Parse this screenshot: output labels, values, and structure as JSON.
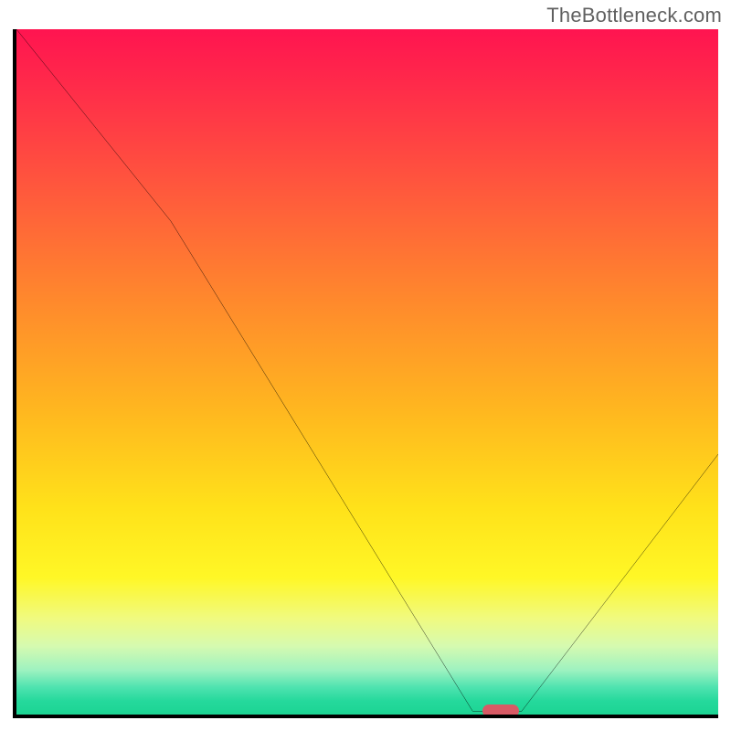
{
  "watermark": "TheBottleneck.com",
  "plot": {
    "x_range": [
      0,
      100
    ],
    "y_range": [
      0,
      100
    ],
    "note": "Axis ranges are normalized percentages; the original image has no numeric tick labels."
  },
  "chart_data": {
    "type": "line",
    "title": "",
    "xlabel": "",
    "ylabel": "",
    "xlim": [
      0,
      100
    ],
    "ylim": [
      0,
      100
    ],
    "x": [
      0,
      22,
      65,
      72,
      100
    ],
    "series": [
      {
        "name": "curve",
        "values": [
          100,
          72,
          0.5,
          0.5,
          38
        ]
      }
    ],
    "marker": {
      "x": 69,
      "y": 0.5
    },
    "background_gradient": {
      "orientation": "vertical",
      "stops": [
        {
          "pct": 0,
          "color": "#ff1450"
        },
        {
          "pct": 24,
          "color": "#ff5a3c"
        },
        {
          "pct": 56,
          "color": "#ffb81f"
        },
        {
          "pct": 80,
          "color": "#fff726"
        },
        {
          "pct": 93.5,
          "color": "#9ef2c0"
        },
        {
          "pct": 100,
          "color": "#1cd493"
        }
      ]
    }
  }
}
